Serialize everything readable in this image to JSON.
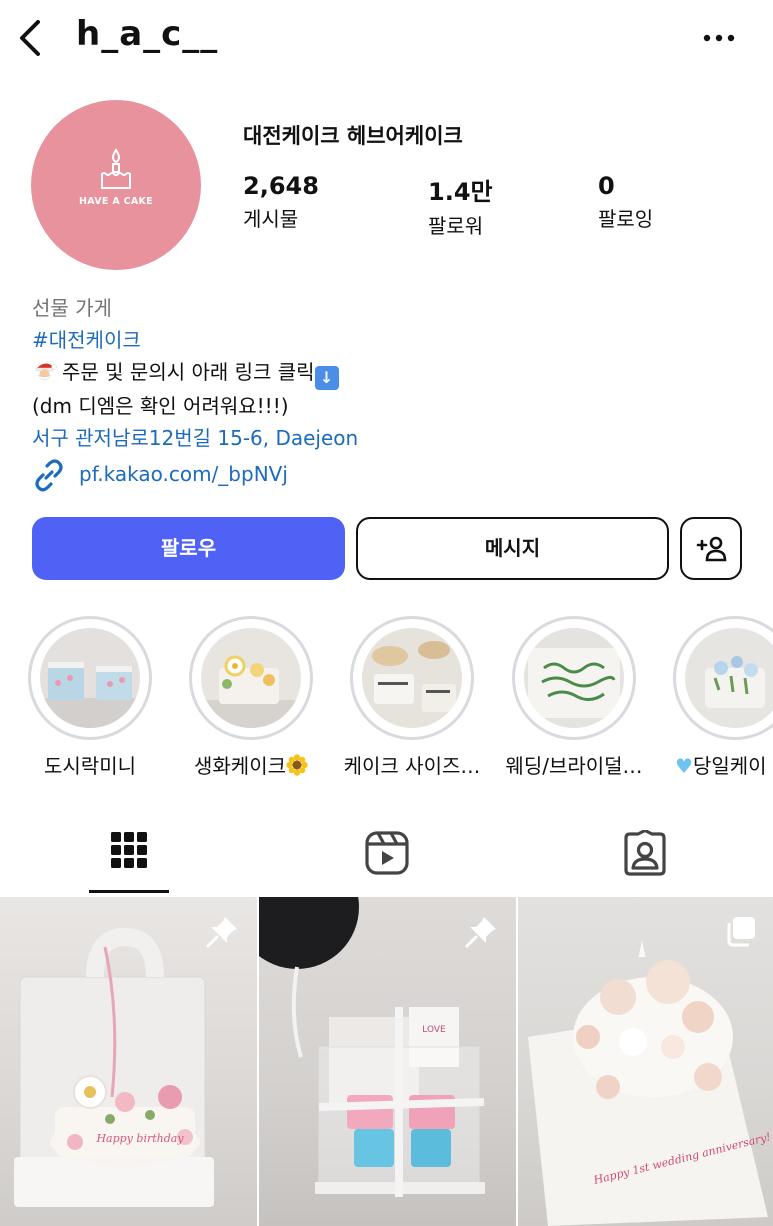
{
  "header": {
    "username": "h_a_c__",
    "back_icon": "chevron-left-icon",
    "more_icon": "more-horizontal-icon"
  },
  "profile": {
    "avatar_logo_text": "HAVE A CAKE",
    "full_name": "대전케이크 헤브어케이크",
    "stats": {
      "posts": {
        "value": "2,648",
        "label": "게시물"
      },
      "followers": {
        "value": "1.4만",
        "label": "팔로워"
      },
      "following": {
        "value": "0",
        "label": "팔로잉"
      }
    },
    "category": "선물 가게",
    "hashtag": "#대전케이크",
    "bio_line1": "주문 및 문의시 아래 링크 클릭",
    "bio_line2": "(dm 디엠은 확인 어려워요!!!)",
    "address": "서구 관저남로12번길 15-6, Daejeon",
    "link": "pf.kakao.com/_bpNVj"
  },
  "actions": {
    "follow_label": "팔로우",
    "message_label": "메시지",
    "add_user_icon": "add-user-icon"
  },
  "highlights": [
    {
      "label": "도시락미니"
    },
    {
      "label": "생화케이크"
    },
    {
      "label": "케이크 사이즈…"
    },
    {
      "label": "웨딩/브라이덜…"
    },
    {
      "label": "당일케이"
    }
  ],
  "tabs": [
    {
      "name": "posts-grid",
      "icon": "grid-icon",
      "active": true
    },
    {
      "name": "reels",
      "icon": "reels-icon",
      "active": false
    },
    {
      "name": "tagged",
      "icon": "tagged-user-icon",
      "active": false
    }
  ],
  "posts": [
    {
      "badge": "pin-icon",
      "cake_text": "Happy birthday"
    },
    {
      "badge": "pin-icon",
      "cake_text": "LOVE"
    },
    {
      "badge": "multiple-posts-icon",
      "cake_text": "Happy 1st wedding anniversary!"
    }
  ],
  "colors": {
    "follow_button": "#4f62f5",
    "link_blue": "#1c6bbd",
    "avatar_pink": "#e7929d"
  }
}
